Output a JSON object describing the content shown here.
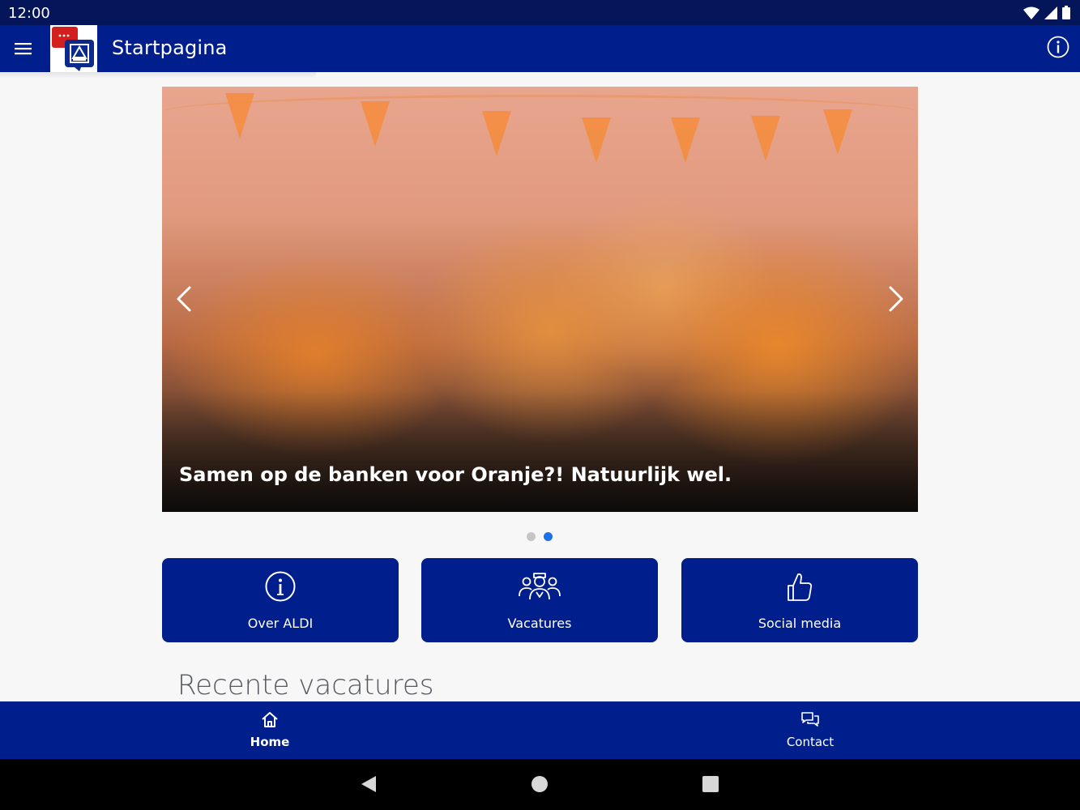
{
  "status": {
    "time": "12:00"
  },
  "appbar": {
    "title": "Startpagina"
  },
  "carousel": {
    "caption": "Samen op de banken voor Oranje?! Natuurlijk wel.",
    "slide_count": 2,
    "active_slide": 2
  },
  "tiles": [
    {
      "label": "Over ALDI",
      "icon": "info-circle-icon"
    },
    {
      "label": "Vacatures",
      "icon": "people-group-icon"
    },
    {
      "label": "Social media",
      "icon": "thumbs-up-icon"
    }
  ],
  "section": {
    "title": "Recente vacatures"
  },
  "bottom_nav": [
    {
      "label": "Home",
      "icon": "home-icon",
      "active": true
    },
    {
      "label": "Contact",
      "icon": "chat-bubbles-icon",
      "active": false
    }
  ],
  "colors": {
    "brand_blue": "#001e8c",
    "status_bar": "#04155a",
    "dot_active": "#1c73e8"
  }
}
